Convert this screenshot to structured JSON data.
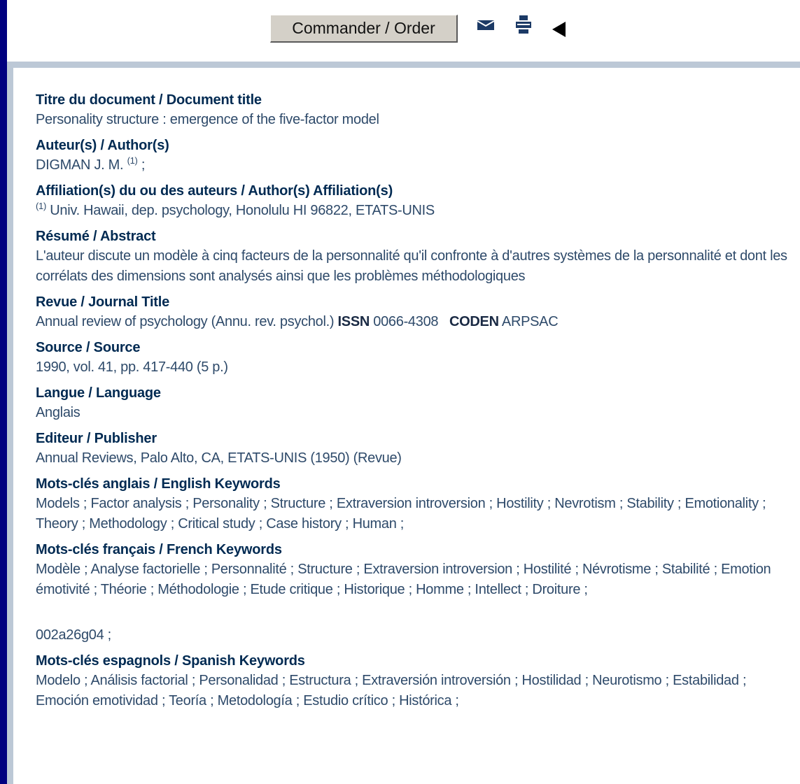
{
  "toolbar": {
    "order_label": "Commander / Order",
    "icons": [
      "mail-icon",
      "print-icon",
      "back-arrow-icon"
    ]
  },
  "record": {
    "title_label": "Titre du document / Document title",
    "title": "Personality structure : emergence of the five-factor model",
    "authors_label": "Auteur(s) / Author(s)",
    "author_name": "DIGMAN J. M.",
    "author_ref": "(1)",
    "author_sep": ";",
    "affiliation_label": "Affiliation(s) du ou des auteurs / Author(s) Affiliation(s)",
    "affiliation_ref": "(1)",
    "affiliation": "Univ. Hawaii, dep. psychology, Honolulu HI 96822, ETATS-UNIS",
    "abstract_label": "Résumé / Abstract",
    "abstract": "L'auteur discute un modèle à cinq facteurs de la personnalité qu'il confronte à d'autres systèmes de la personnalité et dont les corrélats des dimensions sont analysés ainsi que les problèmes méthodologiques",
    "journal_label": "Revue / Journal Title",
    "journal": "Annual review of psychology  (Annu. rev. psychol.)",
    "issn_label": "ISSN",
    "issn": "0066-4308",
    "coden_label": "CODEN",
    "coden": "ARPSAC",
    "source_label": "Source / Source",
    "source": "1990, vol. 41, pp. 417-440 (5 p.)",
    "language_label": "Langue / Language",
    "language": "Anglais",
    "publisher_label": "Editeur / Publisher",
    "publisher": "Annual Reviews, Palo Alto, CA, ETATS-UNIS (1950) (Revue)",
    "en_keywords_label": "Mots-clés anglais / English Keywords",
    "en_keywords": "Models ; Factor analysis ; Personality ; Structure ; Extraversion introversion ; Hostility ; Nevrotism ; Stability ; Emotionality ; Theory ; Methodology ; Critical study ; Case history ; Human ;",
    "fr_keywords_label": "Mots-clés français / French Keywords",
    "fr_keywords": "Modèle ; Analyse factorielle ; Personnalité ; Structure ; Extraversion introversion ; Hostilité ; Névrotisme ; Stabilité ; Emotion émotivité ; Théorie ; Méthodologie ; Etude critique ; Historique ; Homme ; Intellect ; Droiture ;",
    "code": "002a26g04 ;",
    "es_keywords_label": "Mots-clés espagnols / Spanish Keywords",
    "es_keywords": "Modelo ; Análisis factorial ; Personalidad ; Estructura ; Extraversión introversión ; Hostilidad ; Neurotismo ; Estabilidad ; Emoción emotividad ; Teoría ; Metodología ; Estudio crítico ; Histórica ;"
  }
}
